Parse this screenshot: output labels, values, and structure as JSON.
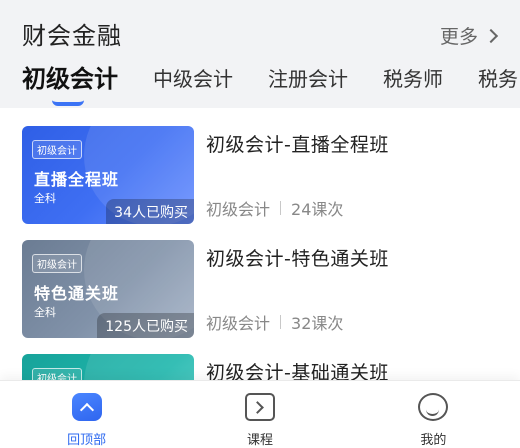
{
  "header": {
    "title": "财会金融",
    "more_label": "更多"
  },
  "tabs": [
    {
      "label": "初级会计",
      "active": true
    },
    {
      "label": "中级会计",
      "active": false
    },
    {
      "label": "注册会计",
      "active": false
    },
    {
      "label": "税务师",
      "active": false
    },
    {
      "label": "税务",
      "active": false
    }
  ],
  "courses": [
    {
      "thumb_tag": "初级会计",
      "thumb_name": "直播全程班",
      "thumb_sub": "全科",
      "buyers": "34人已购买",
      "title": "初级会计-直播全程班",
      "category": "初级会计",
      "lessons": "24课次",
      "theme": "blue"
    },
    {
      "thumb_tag": "初级会计",
      "thumb_name": "特色通关班",
      "thumb_sub": "全科",
      "buyers": "125人已购买",
      "title": "初级会计-特色通关班",
      "category": "初级会计",
      "lessons": "32课次",
      "theme": "gray"
    },
    {
      "thumb_tag": "初级会计",
      "title": "初级会计-基础通关班",
      "theme": "teal"
    }
  ],
  "bottom_nav": [
    {
      "label": "回顶部",
      "icon": "back-to-top-icon",
      "active": true
    },
    {
      "label": "课程",
      "icon": "course-icon",
      "active": false
    },
    {
      "label": "我的",
      "icon": "profile-icon",
      "active": false
    }
  ],
  "colors": {
    "accent": "#2f6bf0",
    "background": "#f2f3f5"
  }
}
